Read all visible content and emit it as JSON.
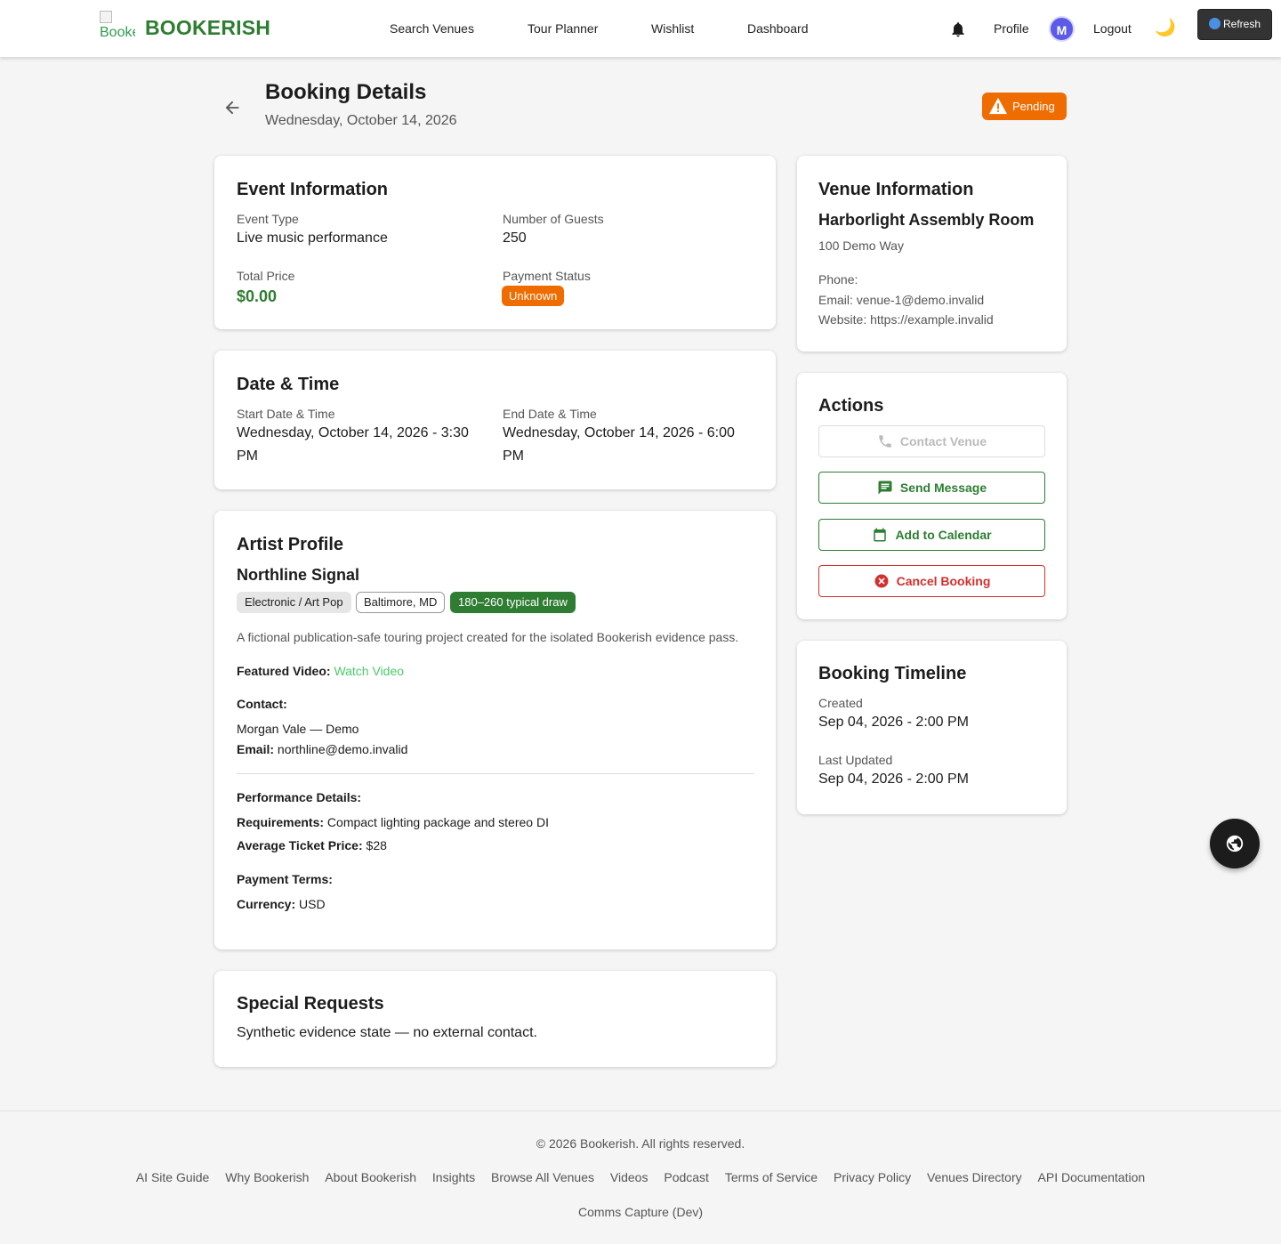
{
  "header": {
    "logo_alt": "Bookerish",
    "brand": "BOOKERISH",
    "nav": [
      "Search Venues",
      "Tour Planner",
      "Wishlist",
      "Dashboard"
    ],
    "profile": "Profile",
    "avatar_initial": "M",
    "logout": "Logout",
    "refresh": "Refresh"
  },
  "page": {
    "title": "Booking Details",
    "subtitle": "Wednesday, October 14, 2026",
    "status": "Pending"
  },
  "event": {
    "title": "Event Information",
    "type_label": "Event Type",
    "type_value": "Live music performance",
    "guests_label": "Number of Guests",
    "guests_value": "250",
    "price_label": "Total Price",
    "price_value": "$0.00",
    "payment_label": "Payment Status",
    "payment_value": "Unknown"
  },
  "datetime": {
    "title": "Date & Time",
    "start_label": "Start Date & Time",
    "start_value": "Wednesday, October 14, 2026 - 3:30 PM",
    "end_label": "End Date & Time",
    "end_value": "Wednesday, October 14, 2026 - 6:00 PM"
  },
  "artist": {
    "title": "Artist Profile",
    "name": "Northline Signal",
    "tags": [
      "Electronic / Art Pop",
      "Baltimore, MD",
      "180–260 typical draw"
    ],
    "description": "A fictional publication-safe touring project created for the isolated Bookerish evidence pass.",
    "video_label": "Featured Video:",
    "video_link": "Watch Video",
    "contact_label": "Contact:",
    "contact_name": "Morgan Vale — Demo",
    "email_label": "Email:",
    "email_value": "northline@demo.invalid",
    "performance_label": "Performance Details:",
    "requirements_label": "Requirements:",
    "requirements_value": "Compact lighting package and stereo DI",
    "ticket_label": "Average Ticket Price:",
    "ticket_value": "$28",
    "payment_terms_label": "Payment Terms:",
    "currency_label": "Currency:",
    "currency_value": "USD"
  },
  "special": {
    "title": "Special Requests",
    "text": "Synthetic evidence state — no external contact."
  },
  "venue": {
    "title": "Venue Information",
    "name": "Harborlight Assembly Room",
    "address": "100 Demo Way",
    "phone": "Phone:",
    "email": "Email: venue-1@demo.invalid",
    "website": "Website: https://example.invalid"
  },
  "actions": {
    "title": "Actions",
    "contact": "Contact Venue",
    "message": "Send Message",
    "calendar": "Add to Calendar",
    "cancel": "Cancel Booking"
  },
  "timeline": {
    "title": "Booking Timeline",
    "created_label": "Created",
    "created_value": "Sep 04, 2026 - 2:00 PM",
    "updated_label": "Last Updated",
    "updated_value": "Sep 04, 2026 - 2:00 PM"
  },
  "footer": {
    "copyright": "© 2026 Bookerish. All rights reserved.",
    "links": [
      "AI Site Guide",
      "Why Bookerish",
      "About Bookerish",
      "Insights",
      "Browse All Venues",
      "Videos",
      "Podcast",
      "Terms of Service",
      "Privacy Policy",
      "Venues Directory",
      "API Documentation"
    ],
    "dev_link": "Comms Capture (Dev)"
  },
  "icons": {
    "bell": "bell-icon",
    "moon": "moon-icon",
    "refresh": "refresh-icon",
    "back": "arrow-left-icon",
    "warning": "warning-icon",
    "phone": "phone-icon",
    "message": "message-icon",
    "calendar": "calendar-icon",
    "cancel": "cancel-circle-icon",
    "globe": "globe-icon"
  },
  "colors": {
    "brand_green": "#2e7d32",
    "warning_orange": "#ef6c00",
    "danger_red": "#d32f2f",
    "link_green": "#4cc96a",
    "avatar_purple": "#5b5be8"
  }
}
